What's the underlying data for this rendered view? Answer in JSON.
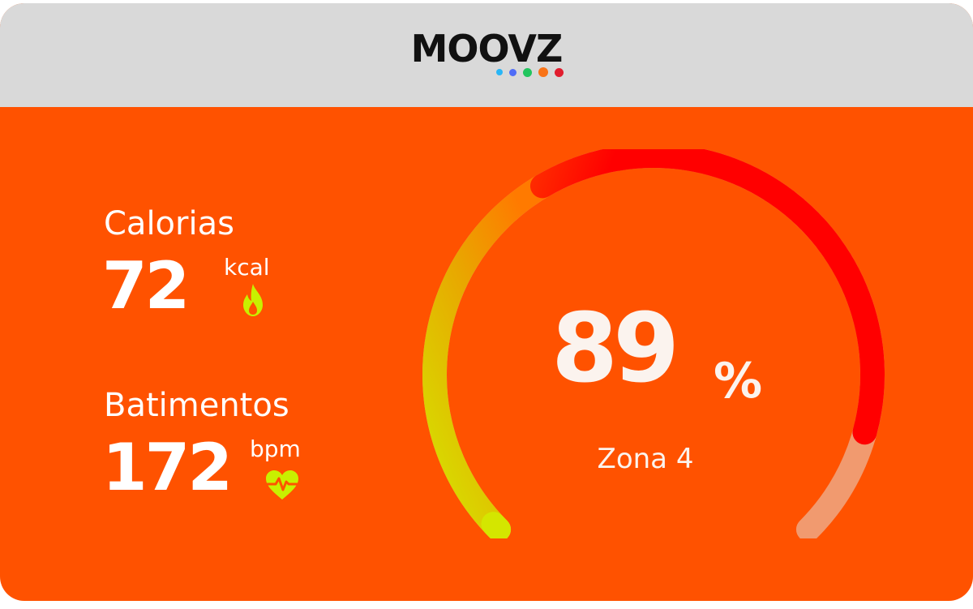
{
  "brand": {
    "name": "MOOVZ",
    "dot_colors": [
      "#29b6f6",
      "#4f6cf7",
      "#22c55e",
      "#f97316",
      "#e11d2e"
    ]
  },
  "stats": {
    "calories": {
      "label": "Calorias",
      "value": "72",
      "unit": "kcal",
      "icon": "flame-icon"
    },
    "heart_rate": {
      "label": "Batimentos",
      "value": "172",
      "unit": "bpm",
      "icon": "heart-pulse-icon"
    }
  },
  "gauge": {
    "value": "89",
    "unit": "%",
    "zone_label": "Zona 4",
    "fill_fraction": 0.89,
    "colors": {
      "start": "#d4e600",
      "mid": "#ff7a00",
      "end": "#ff0000",
      "track": "#f19a6f"
    }
  },
  "colors": {
    "background": "#ff5200",
    "header": "#d9d9d9",
    "icon_accent": "#c8f000"
  }
}
